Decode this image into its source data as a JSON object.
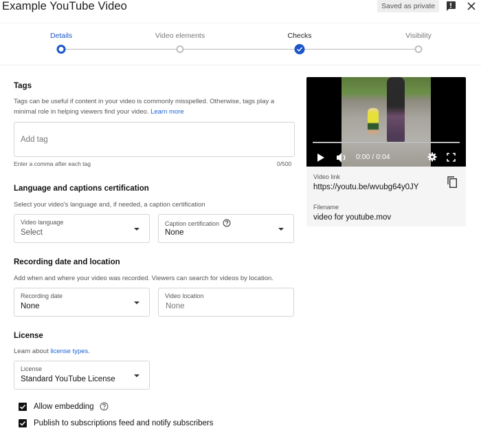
{
  "header": {
    "title": "Example YouTube Video",
    "saved_badge": "Saved as private",
    "feedback_icon": "feedback-icon",
    "close_icon": "close-icon"
  },
  "stepper": {
    "steps": [
      {
        "label": "Details",
        "state": "active"
      },
      {
        "label": "Video elements",
        "state": "todo"
      },
      {
        "label": "Checks",
        "state": "done"
      },
      {
        "label": "Visibility",
        "state": "todo"
      }
    ]
  },
  "tags": {
    "title": "Tags",
    "description": "Tags can be useful if content in your video is commonly misspelled. Otherwise, tags play a minimal role in helping viewers find your video.",
    "learn_more": "Learn more",
    "placeholder": "Add tag",
    "hint": "Enter a comma after each tag",
    "count": "0/500"
  },
  "language": {
    "title": "Language and captions certification",
    "description": "Select your video's language and, if needed, a caption certification",
    "video_language_label": "Video language",
    "video_language_value": "Select",
    "caption_label": "Caption certification",
    "caption_value": "None"
  },
  "recording": {
    "title": "Recording date and location",
    "description": "Add when and where your video was recorded. Viewers can search for videos by location.",
    "date_label": "Recording date",
    "date_value": "None",
    "location_label": "Video location",
    "location_placeholder": "None"
  },
  "license": {
    "title": "License",
    "desc_prefix": "Learn about ",
    "desc_link": "license types",
    "desc_suffix": ".",
    "label": "License",
    "value": "Standard YouTube License"
  },
  "checkboxes": [
    {
      "label": "Allow embedding",
      "checked": true,
      "help": true
    },
    {
      "label": "Publish to subscriptions feed and notify subscribers",
      "checked": true,
      "help": false
    }
  ],
  "preview": {
    "time": "0:00 / 0:04",
    "progress": 0,
    "video_link_label": "Video link",
    "video_link": "https://youtu.be/wvubg64y0JY",
    "filename_label": "Filename",
    "filename": "video for youtube.mov"
  },
  "colors": {
    "accent": "#1a56c9",
    "link": "#1a63d6"
  }
}
